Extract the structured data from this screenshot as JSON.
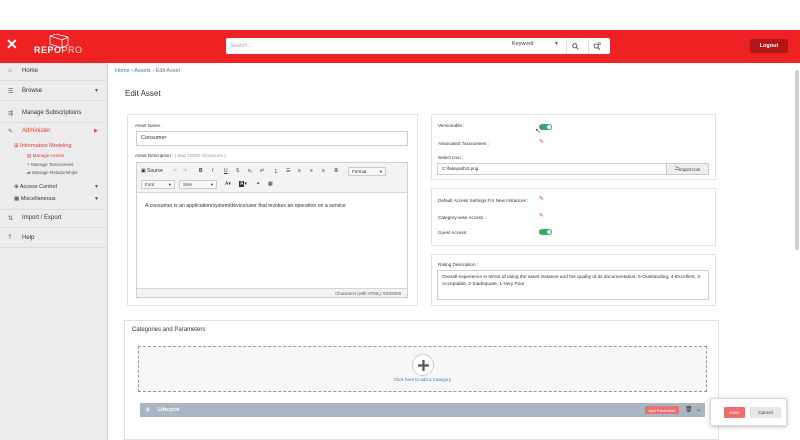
{
  "colors": {
    "brand": "#ee2222",
    "accent": "#e53935",
    "toggle_on": "#3aa864",
    "link": "#3a78c2"
  },
  "header": {
    "logo": "REPOPRO",
    "logo_main": "REPO",
    "logo_suffix": "PRO",
    "search_placeholder": "Search...",
    "search_scope": "Keyword",
    "logout": "Logout"
  },
  "sidebar": {
    "home": "Home",
    "browse": "Browse",
    "manage_subscriptions": "Manage Subscriptions",
    "administer": "Administer",
    "information_modeling": "Information Modeling",
    "manage_assets": "Manage Assets",
    "manage_taxonomies": "Manage Taxonomies",
    "manage_relationships": "Manage Relationships",
    "access_control": "Access Control",
    "miscellaneous": "Miscellaneous",
    "import_export": "Import / Export",
    "help": "Help"
  },
  "breadcrumb": {
    "home": "Home",
    "assets": "Assets",
    "current": "Edit Asset"
  },
  "page_title": "Edit Asset",
  "asset_form": {
    "name_label": "Asset Name :",
    "name_value": "Consumer",
    "description_label": "Asset Description :",
    "description_hint": "( Max 10000 characters )",
    "description_value": "A consumer is an application/system/device/user that invokes an operation on a service",
    "char_count": "Characters (with HTML): 93/25000"
  },
  "editor_toolbar": {
    "source": "Source",
    "format": "Format",
    "font": "Font",
    "size": "Size"
  },
  "right_panel": {
    "versionable": "Versionable :",
    "associated_taxonomies": "Associated Taxonomies :",
    "select_icon": "Select Icon :",
    "icon_file": "C:\\fakepath\\3.png",
    "import_icon": "Import Icon",
    "default_access": "Default Access Settings For New Instances :",
    "category_access": "Category-wise Access :",
    "guest_access": "Guest Access :",
    "rating_label": "Rating Description :",
    "rating_value": "Overall experience in terms of using the asset instance and the quality of its documentation: 5-Outstanding, 4-Excellent, 3-Acceptable, 2-Inadequate, 1-Very Poor"
  },
  "categories": {
    "title": "Categories and Parameters",
    "add_category": "Click here to add a Category",
    "lifecycle": "Lifecycle",
    "add_parameter": "Add Parameter"
  },
  "actions": {
    "save": "Save",
    "cancel": "Cancel"
  }
}
